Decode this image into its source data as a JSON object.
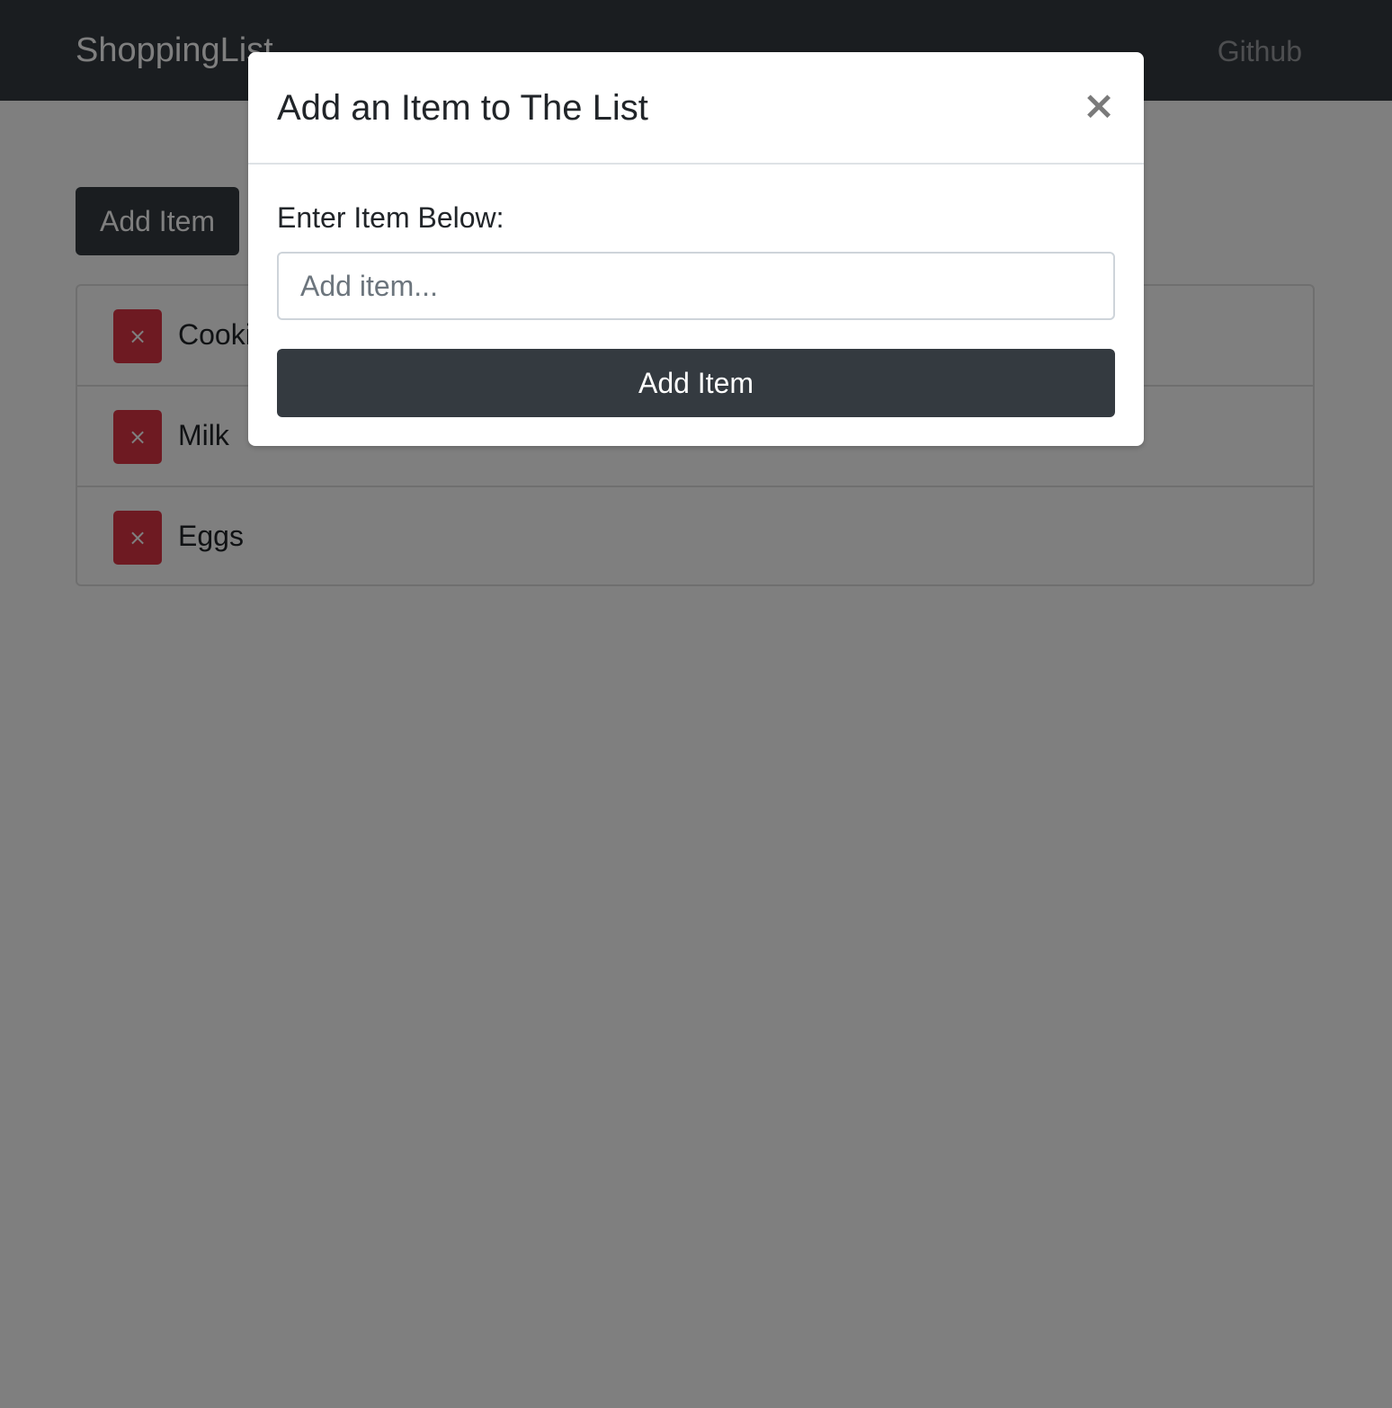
{
  "navbar": {
    "brand": "ShoppingList",
    "link": "Github"
  },
  "main": {
    "add_button_label": "Add Item",
    "items": [
      {
        "name": "Cookies",
        "remove_label": "×"
      },
      {
        "name": "Milk",
        "remove_label": "×"
      },
      {
        "name": "Eggs",
        "remove_label": "×"
      }
    ]
  },
  "modal": {
    "title": "Add an Item to The List",
    "close_label": "×",
    "field_label": "Enter Item Below:",
    "input_placeholder": "Add item...",
    "input_value": "",
    "submit_label": "Add Item"
  },
  "colors": {
    "navbar": "#343a40",
    "danger": "#dc3545",
    "dark_button": "#343a40",
    "backdrop": "rgba(0,0,0,0.5)"
  }
}
